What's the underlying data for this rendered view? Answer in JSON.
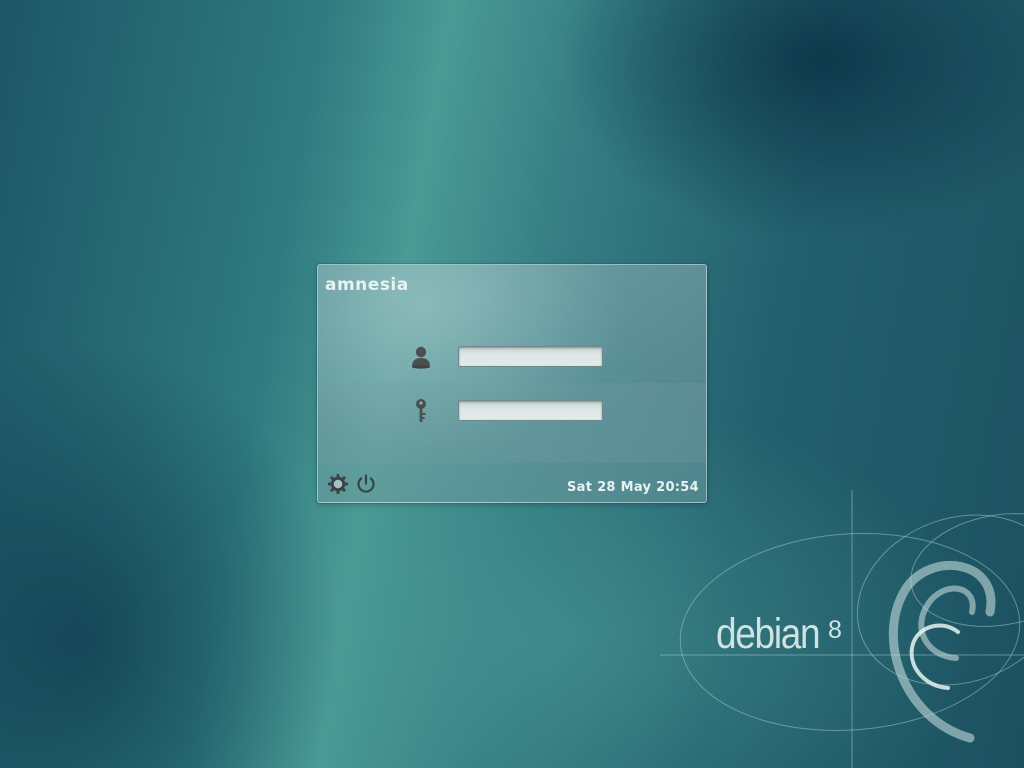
{
  "login": {
    "hostname": "amnesia",
    "username_field": {
      "value": "",
      "placeholder": ""
    },
    "password_field": {
      "value": "",
      "placeholder": ""
    },
    "datetime": "Sat 28 May 20:54",
    "icons": {
      "username": "user-icon",
      "password": "key-icon",
      "settings": "gear-icon",
      "power": "power-icon"
    }
  },
  "branding": {
    "name": "debian",
    "version": "8"
  },
  "colors": {
    "background_dark": "#1c5160",
    "background_light": "#4a9a95",
    "panel_text": "#e8f2f2",
    "logo_text": "#cfe3e0"
  }
}
